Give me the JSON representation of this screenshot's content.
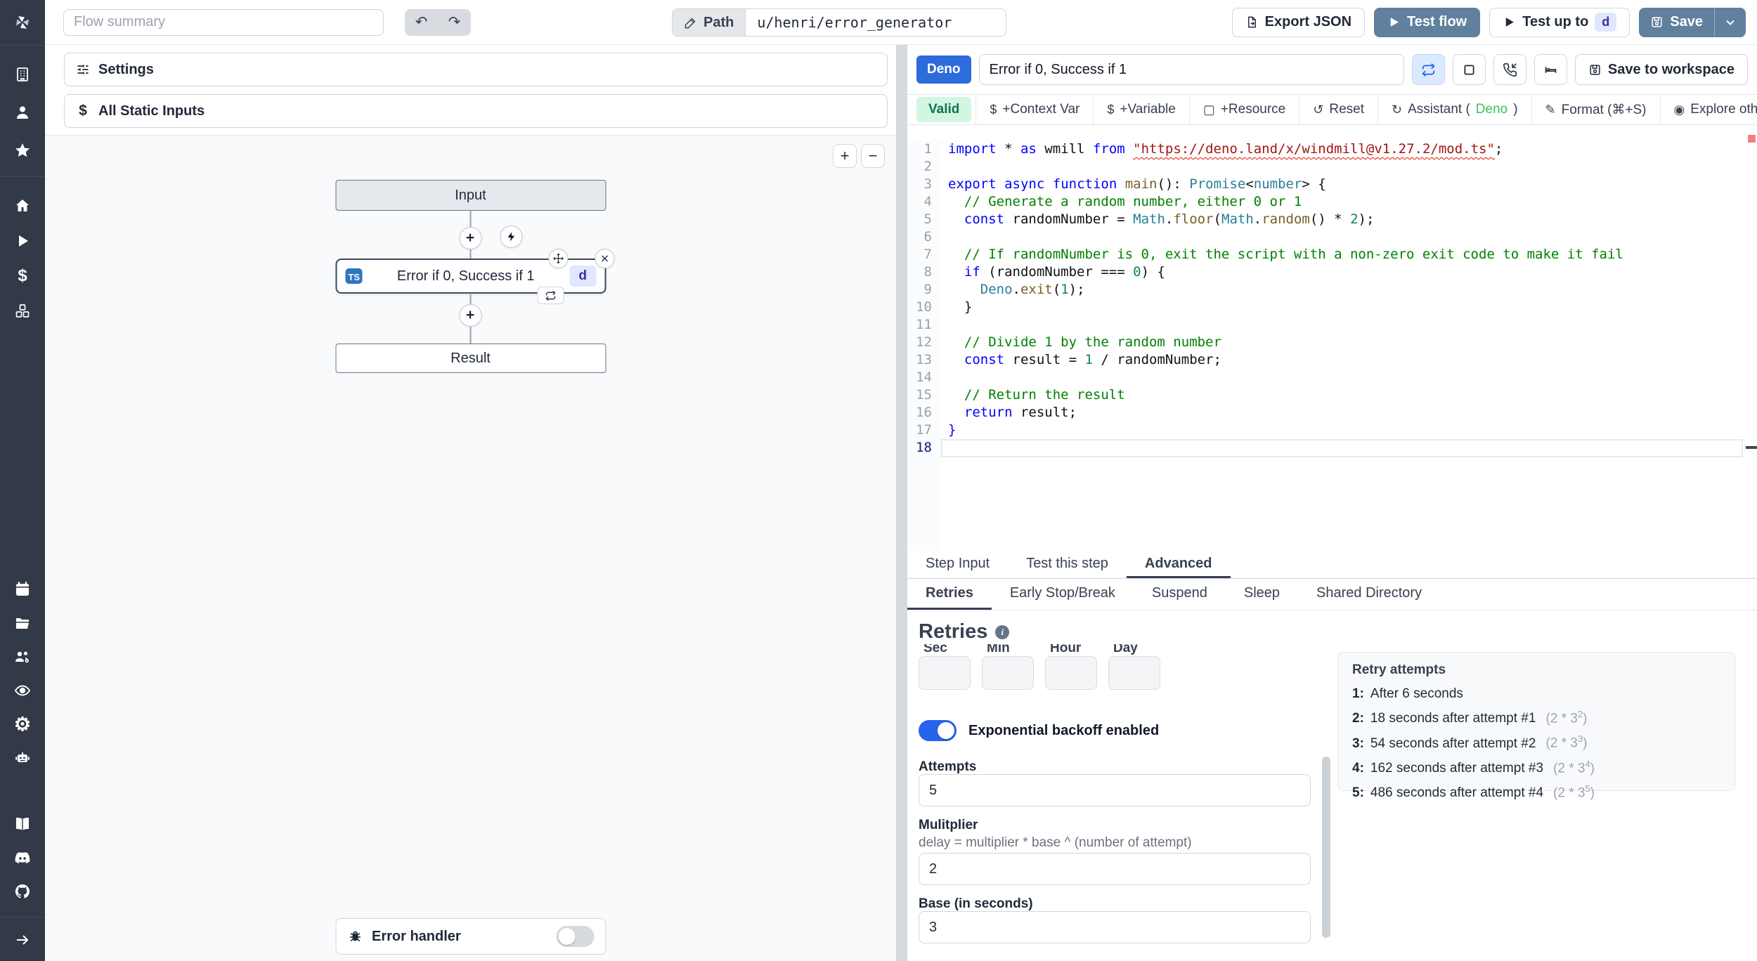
{
  "icons_map": {
    "undo": "↶",
    "redo": "↷",
    "zoom_in": "+",
    "zoom_out": "−",
    "dollar": "$",
    "box": "▢",
    "reset": "↺",
    "assistant": "↻",
    "format": "✎",
    "eye": "◉",
    "plus": "+",
    "close": "×"
  },
  "topbar": {
    "flow_summary_placeholder": "Flow summary",
    "path_label": "Path",
    "path_value": "u/henri/error_generator",
    "export_json": "Export JSON",
    "test_flow": "Test flow",
    "test_up_to": "Test up to",
    "test_up_to_badge": "d",
    "save": "Save"
  },
  "sidebar": {
    "icons": [
      "windmill-logo",
      "building",
      "user",
      "star",
      "home",
      "play",
      "dollar",
      "boxes",
      "calendar",
      "folder",
      "user-group",
      "eye",
      "gear",
      "robot",
      "book",
      "discord",
      "github",
      "arrow-right"
    ]
  },
  "left_panel": {
    "settings": "Settings",
    "all_static_inputs": "All Static Inputs",
    "error_handler": "Error handler"
  },
  "flow": {
    "input_label": "Input",
    "step": {
      "lang": "TS",
      "label": "Error if 0, Success if 1",
      "badge": "d"
    },
    "result_label": "Result"
  },
  "editor": {
    "lang_badge": "Deno",
    "step_name": "Error if 0, Success if 1",
    "save_to_workspace": "Save to workspace",
    "toolbar": {
      "valid": "Valid",
      "buttons": [
        {
          "name": "context-var",
          "icon": "dollar",
          "label": "+Context Var"
        },
        {
          "name": "variable",
          "icon": "dollar",
          "label": "+Variable"
        },
        {
          "name": "resource",
          "icon": "box",
          "label": "+Resource"
        },
        {
          "name": "reset",
          "icon": "reset",
          "label": "Reset"
        },
        {
          "name": "assistant",
          "icon": "assistant",
          "label": "Assistant (",
          "accent": "Deno",
          "suffix": ")"
        },
        {
          "name": "format",
          "icon": "format",
          "label": "Format (⌘+S)"
        },
        {
          "name": "explore",
          "icon": "eye",
          "label": "Explore other s"
        }
      ]
    },
    "active_line": 18,
    "lines": [
      [
        [
          "kw",
          "import"
        ],
        [
          "pl",
          " * "
        ],
        [
          "kw",
          "as"
        ],
        [
          "pl",
          " wmill "
        ],
        [
          "kw",
          "from"
        ],
        [
          "pl",
          " "
        ],
        [
          "sq",
          "\"https://deno.land/x/windmill@v1.27.2/mod.ts\""
        ],
        [
          "pl",
          ";"
        ]
      ],
      [],
      [
        [
          "kw",
          "export"
        ],
        [
          "pl",
          " "
        ],
        [
          "kw",
          "async"
        ],
        [
          "pl",
          " "
        ],
        [
          "kw",
          "function"
        ],
        [
          "pl",
          " "
        ],
        [
          "fn",
          "main"
        ],
        [
          "pl",
          "(): "
        ],
        [
          "ty",
          "Promise"
        ],
        [
          "pl",
          "<"
        ],
        [
          "ty",
          "number"
        ],
        [
          "pl",
          "> {"
        ]
      ],
      [
        [
          "com",
          "  // Generate a random number, either 0 or 1"
        ]
      ],
      [
        [
          "pl",
          "  "
        ],
        [
          "kw",
          "const"
        ],
        [
          "pl",
          " randomNumber = "
        ],
        [
          "ty",
          "Math"
        ],
        [
          "pl",
          "."
        ],
        [
          "fn",
          "floor"
        ],
        [
          "pl",
          "("
        ],
        [
          "ty",
          "Math"
        ],
        [
          "pl",
          "."
        ],
        [
          "fn",
          "random"
        ],
        [
          "pl",
          "() * "
        ],
        [
          "num",
          "2"
        ],
        [
          "pl",
          ");"
        ]
      ],
      [],
      [
        [
          "com",
          "  // If randomNumber is 0, exit the script with a non-zero exit code to make it fail"
        ]
      ],
      [
        [
          "pl",
          "  "
        ],
        [
          "kw",
          "if"
        ],
        [
          "pl",
          " (randomNumber === "
        ],
        [
          "num",
          "0"
        ],
        [
          "pl",
          ") {"
        ]
      ],
      [
        [
          "pl",
          "    "
        ],
        [
          "ty",
          "Deno"
        ],
        [
          "pl",
          "."
        ],
        [
          "fn",
          "exit"
        ],
        [
          "pl",
          "("
        ],
        [
          "num",
          "1"
        ],
        [
          "pl",
          ");"
        ]
      ],
      [
        [
          "pl",
          "  }"
        ]
      ],
      [],
      [
        [
          "com",
          "  // Divide 1 by the random number"
        ]
      ],
      [
        [
          "pl",
          "  "
        ],
        [
          "kw",
          "const"
        ],
        [
          "pl",
          " result = "
        ],
        [
          "num",
          "1"
        ],
        [
          "pl",
          " / randomNumber;"
        ]
      ],
      [],
      [
        [
          "com",
          "  // Return the result"
        ]
      ],
      [
        [
          "pl",
          "  "
        ],
        [
          "kw",
          "return"
        ],
        [
          "pl",
          " result;"
        ]
      ],
      [
        [
          "kw",
          "}"
        ]
      ],
      []
    ]
  },
  "tabs": {
    "main": [
      "Step Input",
      "Test this step",
      "Advanced"
    ],
    "sub": [
      "Retries",
      "Early Stop/Break",
      "Suspend",
      "Sleep",
      "Shared Directory"
    ]
  },
  "retries": {
    "heading": "Retries",
    "time_labels": [
      "Sec",
      "Min",
      "Hour",
      "Day"
    ],
    "toggle_label": "Exponential backoff enabled",
    "attempts_label": "Attempts",
    "attempts_value": "5",
    "multiplier_label": "Mulitplier",
    "multiplier_desc": "delay = multiplier * base ^ (number of attempt)",
    "multiplier_value": "2",
    "base_label": "Base (in seconds)",
    "base_value": "3",
    "retry_attempts": {
      "title": "Retry attempts",
      "items": [
        {
          "n": "1:",
          "text": "After 6 seconds",
          "formula": null,
          "sup": null
        },
        {
          "n": "2:",
          "text": "18 seconds after attempt #1",
          "formula": "(2 * 3",
          "sup": "2"
        },
        {
          "n": "3:",
          "text": "54 seconds after attempt #2",
          "formula": "(2 * 3",
          "sup": "3"
        },
        {
          "n": "4:",
          "text": "162 seconds after attempt #3",
          "formula": "(2 * 3",
          "sup": "4"
        },
        {
          "n": "5:",
          "text": "486 seconds after attempt #4",
          "formula": "(2 * 3",
          "sup": "5"
        }
      ]
    }
  }
}
